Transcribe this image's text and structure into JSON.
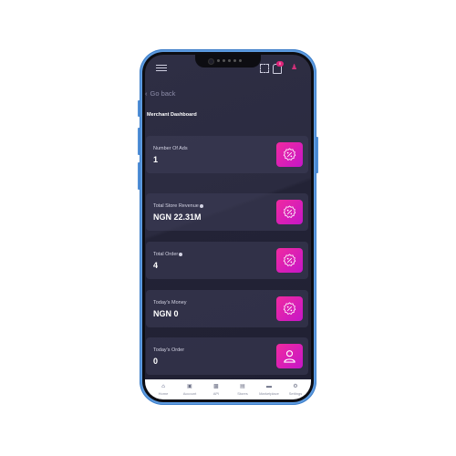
{
  "header": {
    "notification_count": "0"
  },
  "nav": {
    "back_label": "Go back",
    "page_title": "Merchant Dashboard"
  },
  "cards": [
    {
      "label": "Number Of Ads",
      "value": "1",
      "info": false,
      "icon": "percent-badge-icon"
    },
    {
      "label": "Total Store Revenue",
      "value": "NGN 22.31M",
      "info": true,
      "icon": "percent-badge-icon"
    },
    {
      "label": "Total Order",
      "value": "4",
      "info": true,
      "icon": "percent-badge-icon"
    },
    {
      "label": "Today's Money",
      "value": "NGN 0",
      "info": false,
      "icon": "percent-badge-icon"
    },
    {
      "label": "Today's Order",
      "value": "0",
      "info": false,
      "icon": "user-icon"
    }
  ],
  "bottom_nav": [
    {
      "label": "Home",
      "icon": "home-icon",
      "active": true
    },
    {
      "label": "Account",
      "icon": "camera-icon",
      "active": false
    },
    {
      "label": "API",
      "icon": "api-icon",
      "active": false
    },
    {
      "label": "Stores",
      "icon": "stores-icon",
      "active": false
    },
    {
      "label": "Marketplace",
      "icon": "folder-icon",
      "active": false
    },
    {
      "label": "Settings",
      "icon": "gear-icon",
      "active": false
    }
  ],
  "colors": {
    "accent_start": "#f02aa0",
    "accent_end": "#c516c8",
    "screen_bg": "#2b2b40",
    "phone_frame": "#5d9be0"
  }
}
